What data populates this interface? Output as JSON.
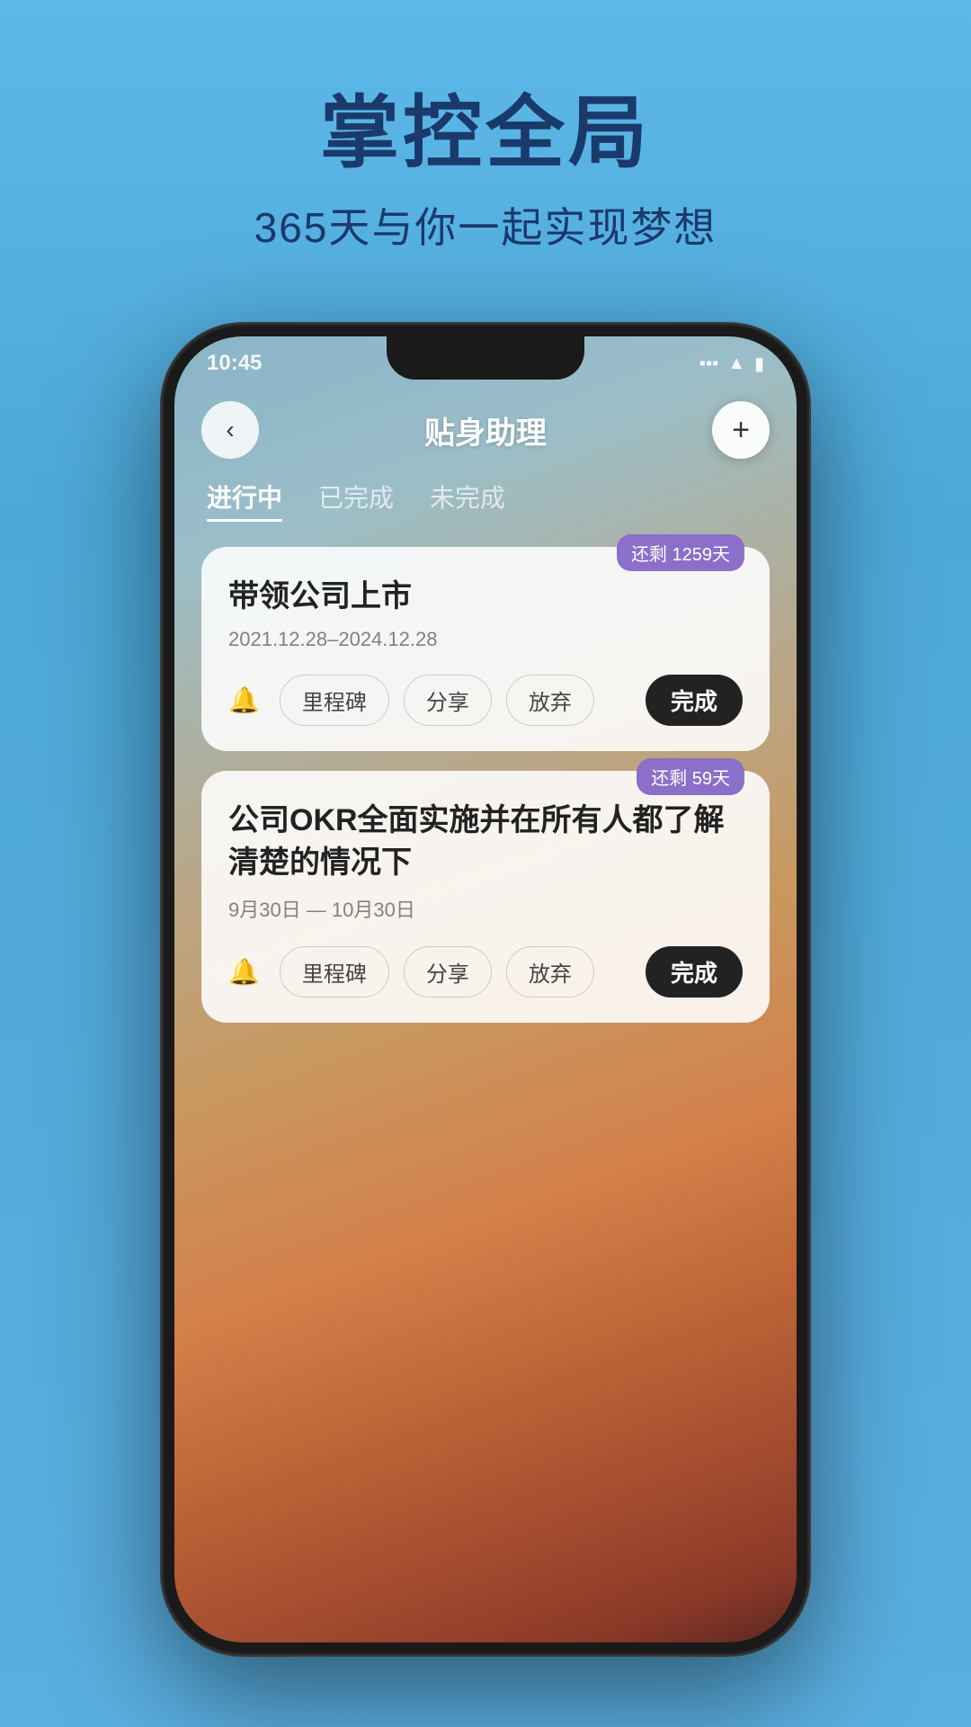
{
  "page": {
    "bg_color": "#5aaee0"
  },
  "header": {
    "main_title": "掌控全局",
    "sub_title": "365天与你一起实现梦想"
  },
  "phone": {
    "status_time": "10:45",
    "nav_title": "贴身助理",
    "back_label": "‹",
    "add_label": "+",
    "tabs": [
      {
        "label": "进行中",
        "active": true
      },
      {
        "label": "已完成",
        "active": false
      },
      {
        "label": "未完成",
        "active": false
      }
    ],
    "cards": [
      {
        "badge": "还剩 1259天",
        "title": "带领公司上市",
        "date": "2021.12.28–2024.12.28",
        "actions": [
          "里程碑",
          "分享",
          "放弃"
        ],
        "complete": "完成"
      },
      {
        "badge": "还剩 59天",
        "title": "公司OKR全面实施并在所有人都了解清楚的情况下",
        "date": "9月30日 — 10月30日",
        "actions": [
          "里程碑",
          "分享",
          "放弃"
        ],
        "complete": "完成"
      }
    ]
  }
}
